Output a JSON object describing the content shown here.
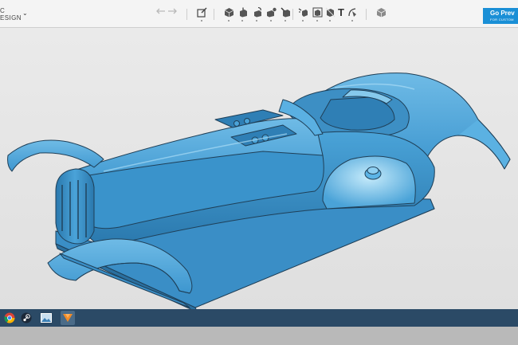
{
  "app": {
    "brand_line1": "C",
    "brand_line2": "ESIGN",
    "caret": "⌄"
  },
  "toolbar": {
    "undo_icon": "undo-arrow-icon",
    "redo_icon": "redo-arrow-icon",
    "tools": [
      {
        "name": "sketch-tool-icon"
      },
      {
        "name": "primitive-box-icon"
      },
      {
        "name": "extrude-icon"
      },
      {
        "name": "revolve-icon"
      },
      {
        "name": "sweep-icon"
      },
      {
        "name": "modify-icon"
      },
      {
        "name": "pattern-icon"
      },
      {
        "name": "group-icon"
      },
      {
        "name": "text-tool-icon",
        "label": "T"
      },
      {
        "name": "measure-icon"
      },
      {
        "name": "material-box-icon"
      }
    ]
  },
  "preview_button": {
    "label": "Go Prev",
    "sub_label": "FOR CUSTOM"
  },
  "viewport": {
    "model_color": "#4aa3d8",
    "model_dark": "#2a78ad",
    "model_light": "#8fd0f2",
    "background": "#e6e6e6"
  },
  "taskbar": {
    "icons": [
      "chrome-icon",
      "steam-icon",
      "image-viewer-icon",
      "fusion-360-icon"
    ],
    "background": "#2b4a66"
  }
}
